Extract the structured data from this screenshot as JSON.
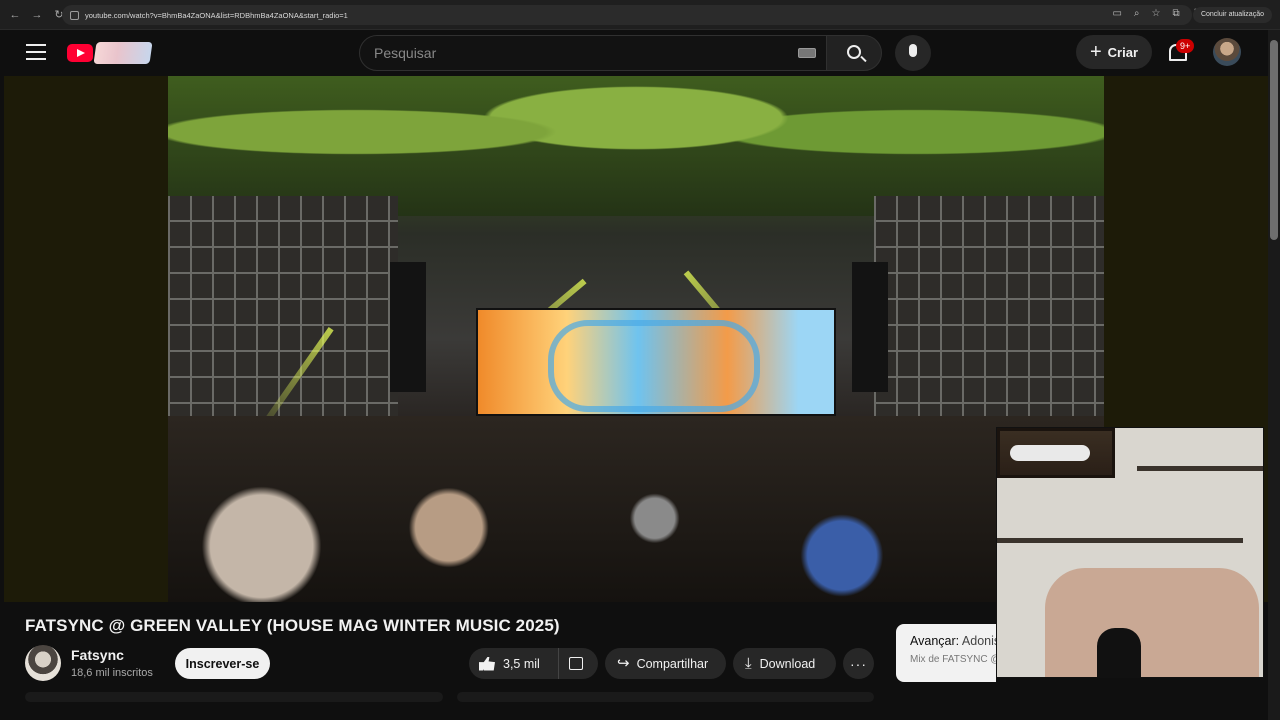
{
  "browser": {
    "url": "youtube.com/watch?v=BhmBa4ZaONA&list=RDBhmBa4ZaONA&start_radio=1",
    "update_label": "Concluir atualização"
  },
  "header": {
    "search_placeholder": "Pesquisar",
    "create_label": "Criar",
    "notifications_badge": "9+"
  },
  "video": {
    "title": "FATSYNC @ GREEN VALLEY (HOUSE MAG WINTER MUSIC 2025)",
    "channel_name": "Fatsync",
    "subscribers": "18,6 mil inscritos",
    "subscribe_label": "Inscrever-se",
    "likes": "3,5 mil",
    "share_label": "Compartilhar",
    "download_label": "Download",
    "more_label": "···"
  },
  "up_next": {
    "prefix": "Avançar:",
    "title": "Adonis",
    "subtitle": "Mix de FATSYNC @"
  },
  "colors": {
    "accent": "#ff0033",
    "badge": "#cc0000",
    "background": "#0f0f0f"
  }
}
